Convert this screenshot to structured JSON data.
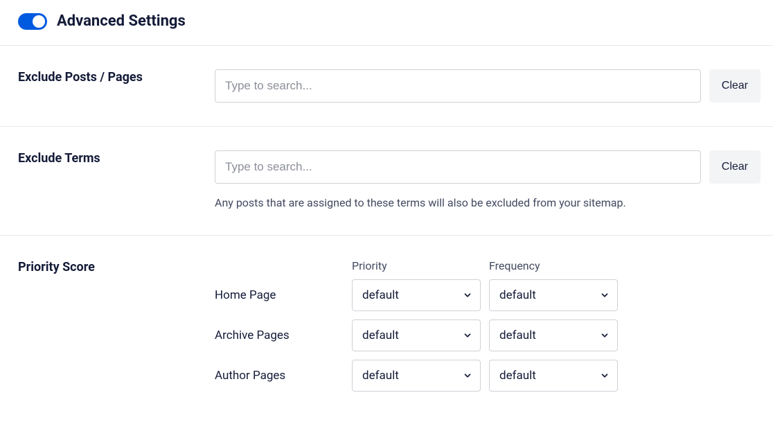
{
  "header": {
    "title": "Advanced Settings",
    "toggle_on": true
  },
  "exclude_posts": {
    "label": "Exclude Posts / Pages",
    "placeholder": "Type to search...",
    "value": "",
    "clear_label": "Clear"
  },
  "exclude_terms": {
    "label": "Exclude Terms",
    "placeholder": "Type to search...",
    "value": "",
    "clear_label": "Clear",
    "helper": "Any posts that are assigned to these terms will also be excluded from your sitemap."
  },
  "priority": {
    "label": "Priority Score",
    "col_priority": "Priority",
    "col_frequency": "Frequency",
    "rows": [
      {
        "label": "Home Page",
        "priority": "default",
        "frequency": "default"
      },
      {
        "label": "Archive Pages",
        "priority": "default",
        "frequency": "default"
      },
      {
        "label": "Author Pages",
        "priority": "default",
        "frequency": "default"
      }
    ]
  }
}
